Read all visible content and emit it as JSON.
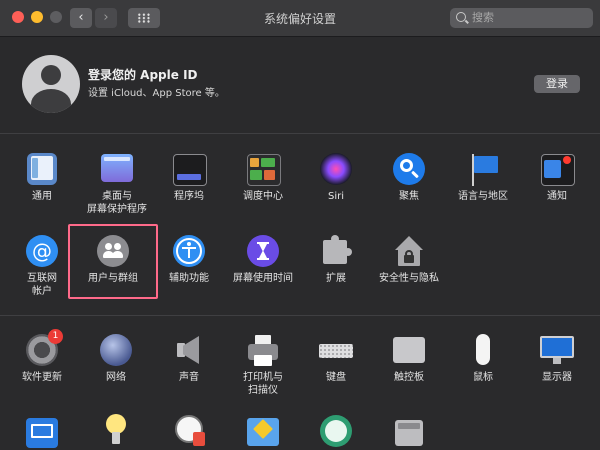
{
  "window": {
    "title": "系统偏好设置"
  },
  "toolbar": {
    "back": "‹",
    "forward": "›",
    "search_placeholder": "搜索"
  },
  "account": {
    "title": "登录您的 Apple ID",
    "subtitle": "设置 iCloud、App Store 等。",
    "login_label": "登录"
  },
  "prefs": {
    "general": "通用",
    "desktop_line1": "桌面与",
    "desktop_line2": "屏幕保护程序",
    "dock": "程序坞",
    "mission_control": "调度中心",
    "siri": "Siri",
    "spotlight": "聚焦",
    "language_region": "语言与地区",
    "notifications": "通知",
    "internet_line1": "互联网",
    "internet_line2": "帐户",
    "users_groups": "用户与群组",
    "accessibility": "辅助功能",
    "screen_time": "屏幕使用时间",
    "extensions": "扩展",
    "security_privacy": "安全性与隐私",
    "software_update": "软件更新",
    "software_update_badge": "1",
    "network": "网络",
    "sound": "声音",
    "printers_line1": "打印机与",
    "printers_line2": "扫描仪",
    "keyboard": "键盘",
    "trackpad": "触控板",
    "mouse": "鼠标",
    "displays": "显示器"
  }
}
